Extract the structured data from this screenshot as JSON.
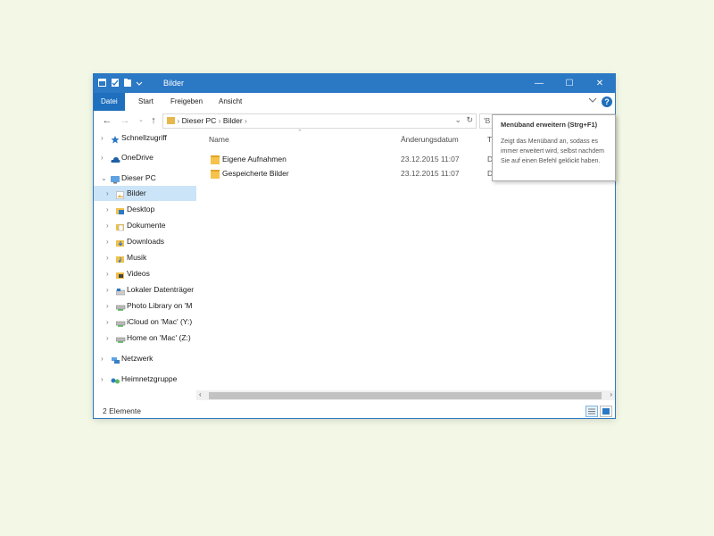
{
  "window": {
    "title": "Bilder",
    "controls": {
      "minimize": "—",
      "maximize": "☐",
      "close": "✕"
    }
  },
  "ribbon": {
    "tabs": [
      {
        "label": "Datei",
        "active": true
      },
      {
        "label": "Start",
        "active": false
      },
      {
        "label": "Freigeben",
        "active": false
      },
      {
        "label": "Ansicht",
        "active": false
      }
    ],
    "expand_icon": "chevron-down-icon",
    "help_icon": "help-icon",
    "help_label": "?"
  },
  "address": {
    "breadcrumbs": [
      "Dieser PC",
      "Bilder"
    ],
    "crumb_sep": "›",
    "search_placeholder": "'B"
  },
  "nav": {
    "items": [
      {
        "label": "Schnellzugriff",
        "icon": "star-icon",
        "level": 0,
        "chevron": "›"
      },
      {
        "label": "OneDrive",
        "icon": "cloud-icon",
        "level": 0,
        "chevron": "›"
      },
      {
        "label": "Dieser PC",
        "icon": "computer-icon",
        "level": 0,
        "chevron": "⌄"
      },
      {
        "label": "Bilder",
        "icon": "pictures-folder-icon",
        "level": 1,
        "chevron": "›",
        "selected": true
      },
      {
        "label": "Desktop",
        "icon": "desktop-folder-icon",
        "level": 1,
        "chevron": "›"
      },
      {
        "label": "Dokumente",
        "icon": "documents-folder-icon",
        "level": 1,
        "chevron": "›"
      },
      {
        "label": "Downloads",
        "icon": "downloads-folder-icon",
        "level": 1,
        "chevron": "›"
      },
      {
        "label": "Musik",
        "icon": "music-folder-icon",
        "level": 1,
        "chevron": "›"
      },
      {
        "label": "Videos",
        "icon": "videos-folder-icon",
        "level": 1,
        "chevron": "›"
      },
      {
        "label": "Lokaler Datenträger",
        "icon": "drive-icon",
        "level": 1,
        "chevron": "›"
      },
      {
        "label": "Photo Library on 'M",
        "icon": "network-drive-icon",
        "level": 1,
        "chevron": "›"
      },
      {
        "label": "iCloud on 'Mac' (Y:)",
        "icon": "network-drive-icon",
        "level": 1,
        "chevron": "›"
      },
      {
        "label": "Home on 'Mac' (Z:)",
        "icon": "network-drive-icon",
        "level": 1,
        "chevron": "›"
      },
      {
        "label": "Netzwerk",
        "icon": "network-icon",
        "level": 0,
        "chevron": "›"
      },
      {
        "label": "Heimnetzgruppe",
        "icon": "homegroup-icon",
        "level": 0,
        "chevron": "›"
      }
    ]
  },
  "content": {
    "columns": {
      "name": "Name",
      "date": "Änderungsdatum",
      "type": "T"
    },
    "sort_arrow": "⌃",
    "files": [
      {
        "name": "Eigene Aufnahmen",
        "date": "23.12.2015 11:07",
        "type": "D"
      },
      {
        "name": "Gespeicherte Bilder",
        "date": "23.12.2015 11:07",
        "type": "D"
      }
    ]
  },
  "status": {
    "count": "2 Elemente"
  },
  "tooltip": {
    "title": "Menüband erweitern (Strg+F1)",
    "body": "Zeigt das Menüband an, sodass es immer erweitert wird, selbst nachdem Sie auf einen Befehl geklickt haben."
  },
  "colors": {
    "accent": "#2b78c5",
    "selected": "#cce4f7",
    "background": "#f3f8e6"
  }
}
